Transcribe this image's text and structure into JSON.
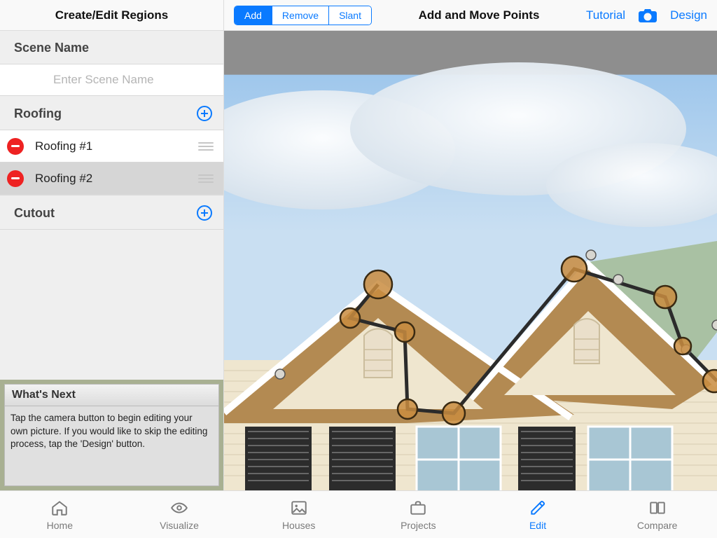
{
  "sidebar": {
    "title": "Create/Edit Regions",
    "scene": {
      "label": "Scene Name",
      "placeholder": "Enter Scene Name",
      "value": ""
    },
    "roofing": {
      "label": "Roofing",
      "items": [
        {
          "label": "Roofing #1",
          "selected": false
        },
        {
          "label": "Roofing #2",
          "selected": true
        }
      ]
    },
    "cutout": {
      "label": "Cutout"
    },
    "whats_next": {
      "title": "What's Next",
      "body": "Tap the camera button to begin editing your own picture. If you would like to skip the editing process, tap the 'Design' button."
    }
  },
  "editor": {
    "segments": {
      "add": "Add",
      "remove": "Remove",
      "slant": "Slant",
      "active": "add"
    },
    "title": "Add and Move Points",
    "links": {
      "tutorial": "Tutorial",
      "design": "Design"
    }
  },
  "tabs": {
    "home": "Home",
    "visualize": "Visualize",
    "houses": "Houses",
    "projects": "Projects",
    "edit": "Edit",
    "compare": "Compare",
    "active": "edit"
  }
}
